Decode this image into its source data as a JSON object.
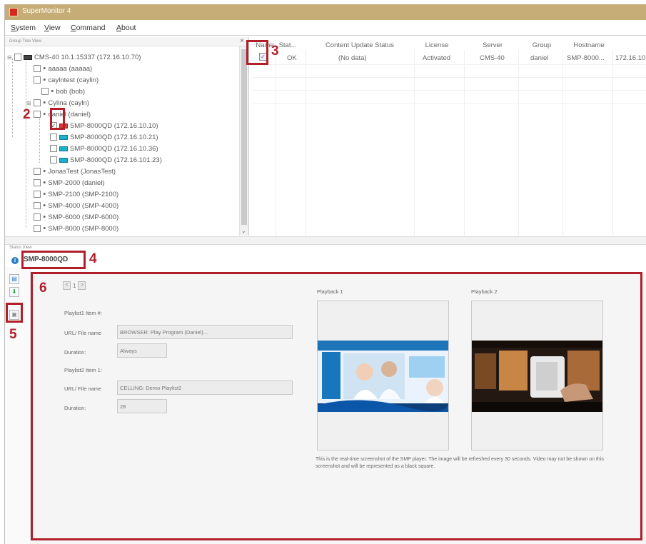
{
  "window": {
    "title": "SuperMonitor 4"
  },
  "menu": [
    "System",
    "View",
    "Command",
    "About"
  ],
  "tree": {
    "header": "Group Tree View",
    "close_glyph": "×",
    "items": [
      {
        "label": "CMS-40  10.1.15337  (172.16.10.70)",
        "checked": false
      },
      {
        "label": "aaaaa  (aaaaa)",
        "checked": false
      },
      {
        "label": "caylntest  (caylin)",
        "checked": false
      },
      {
        "label": "bob  (bob)",
        "checked": false
      },
      {
        "label": "Cylina  (cayln)",
        "checked": false
      },
      {
        "label": "daniel  (daniel)",
        "checked": false
      },
      {
        "label": "SMP-8000QD  (172.16.10.10)",
        "checked": true
      },
      {
        "label": "SMP-8000QD  (172.16.10.21)",
        "checked": false
      },
      {
        "label": "SMP-8000QD  (172.16.10.36)",
        "checked": false
      },
      {
        "label": "SMP-8000QD  (172.16.101.23)",
        "checked": false
      },
      {
        "label": "JonasTest  (JonasTest)",
        "checked": false
      },
      {
        "label": "SMP-2000  (daniel)",
        "checked": false
      },
      {
        "label": "SMP-2100  (SMP-2100)",
        "checked": false
      },
      {
        "label": "SMP-4000  (SMP-4000)",
        "checked": false
      },
      {
        "label": "SMP-6000  (SMP-6000)",
        "checked": false
      },
      {
        "label": "SMP-8000  (SMP-8000)",
        "checked": false
      }
    ]
  },
  "list": {
    "columns": [
      "Name",
      "Stat...",
      "Content Update Status",
      "License",
      "Server",
      "Group",
      "Hostname",
      ""
    ],
    "row": [
      "",
      "OK",
      "(No data)",
      "Activated",
      "CMS-40",
      "daniel",
      "SMP-8000...",
      "172.16.10"
    ]
  },
  "status_view": {
    "header": "Status View",
    "device_tab": "SMP-8000QD",
    "pager": {
      "prev": "<",
      "page": "1",
      "next": ">"
    },
    "playlist1_title": "Playlist1 Item #:",
    "playlist2_title": "Playlist2 Item 1:",
    "url_label": "URL/ File name",
    "duration_label": "Duration:",
    "playlist1_url": "BROWSER: Play Program (Daniel)...",
    "playlist1_duration": "Always",
    "playlist2_url": "CELLING: Demo Playlist2",
    "playlist2_duration": "28",
    "playback1_label": "Playback 1",
    "playback2_label": "Playback 2",
    "note": "This is the real-time screenshot of the SMP player. The image will be refreshed every 30 seconds. Video may not be shown on this screenshot and will be represented as a black square."
  },
  "annotations": [
    "2",
    "3",
    "4",
    "5",
    "6"
  ],
  "colors": {
    "annotation": "#b01f2a",
    "titlebar": "#c6ad78",
    "device_icon": "#1cb0c9"
  }
}
